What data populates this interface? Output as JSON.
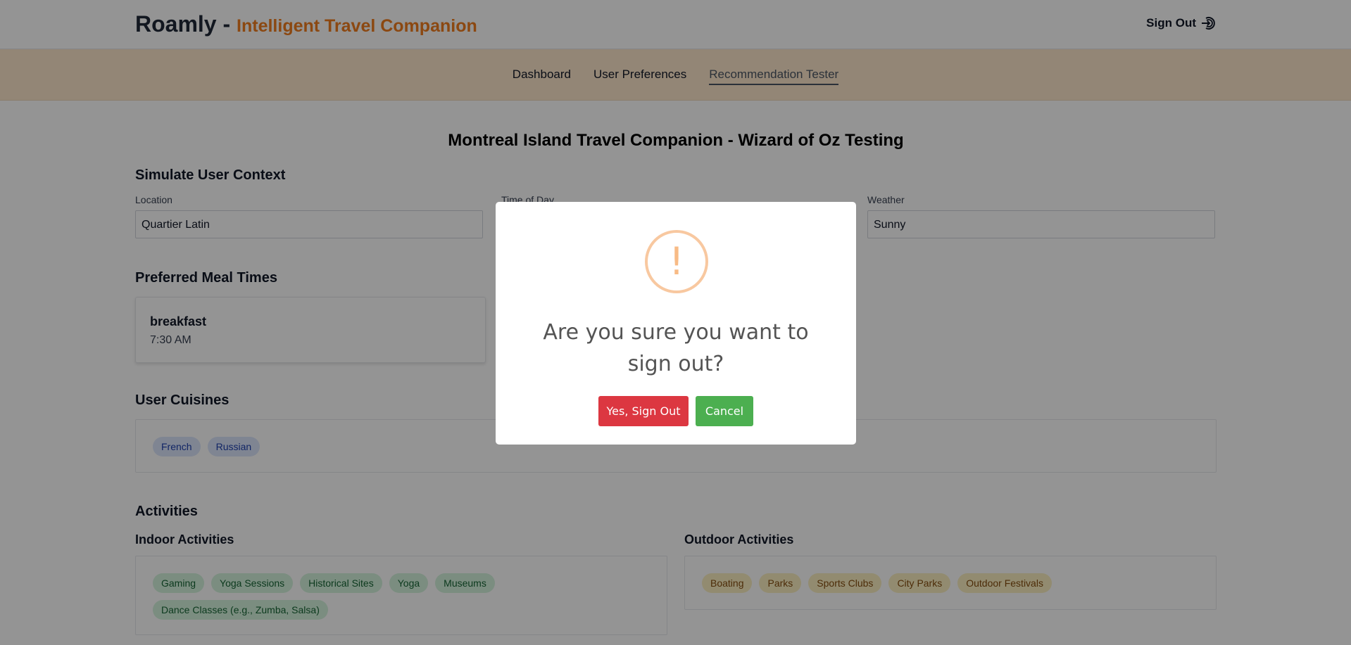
{
  "header": {
    "brand": "Roamly",
    "brand_separator": " - ",
    "tagline": "Intelligent Travel Companion",
    "signout_label": "Sign Out",
    "signout_icon": "sign-out-icon"
  },
  "nav": {
    "items": [
      {
        "label": "Dashboard"
      },
      {
        "label": "User Preferences"
      },
      {
        "label": "Recommendation Tester",
        "active": true
      }
    ]
  },
  "page": {
    "title": "Montreal Island Travel Companion - Wizard of Oz Testing",
    "context_title": "Simulate User Context",
    "fields": {
      "location_label": "Location",
      "location_value": "Quartier Latin",
      "time_label": "Time of Day",
      "weather_label": "Weather",
      "weather_value": "Sunny"
    },
    "meal_title": "Preferred Meal Times",
    "meal": {
      "name": "breakfast",
      "time": "7:30 AM"
    },
    "cuisines_title": "User Cuisines",
    "cuisines": [
      "French",
      "Russian"
    ],
    "activities_title": "Activities",
    "indoor_title": "Indoor Activities",
    "indoor": [
      "Gaming",
      "Yoga Sessions",
      "Historical Sites",
      "Yoga",
      "Museums",
      "Dance Classes (e.g., Zumba, Salsa)"
    ],
    "outdoor_title": "Outdoor Activities",
    "outdoor": [
      "Boating",
      "Parks",
      "Sports Clubs",
      "City Parks",
      "Outdoor Festivals"
    ]
  },
  "modal": {
    "icon": "warning-icon",
    "icon_glyph": "!",
    "message": "Are you sure you want to sign out?",
    "confirm_label": "Yes, Sign Out",
    "cancel_label": "Cancel"
  }
}
